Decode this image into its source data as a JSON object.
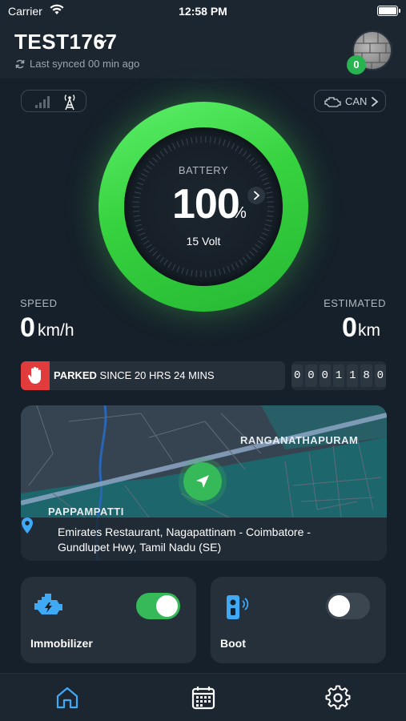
{
  "status_bar": {
    "carrier": "Carrier",
    "time": "12:58 PM"
  },
  "header": {
    "vehicle_name": "TEST1767",
    "sync_text": "Last synced 00 min ago",
    "notification_count": "0"
  },
  "connectivity": {
    "can_label": "CAN"
  },
  "battery": {
    "label": "BATTERY",
    "value": "100",
    "unit": "%",
    "voltage": "15 Volt",
    "level_percent": 100
  },
  "speed": {
    "label": "SPEED",
    "value": "0",
    "unit": "km/h"
  },
  "estimated": {
    "label": "ESTIMATED",
    "value": "0",
    "unit": "km"
  },
  "parked": {
    "status": "PARKED",
    "since_text": " SINCE 20 HRS 24 MINS"
  },
  "odometer": {
    "digits": [
      "0",
      "0",
      "0",
      "1",
      "1",
      "8",
      "0"
    ]
  },
  "map": {
    "labels": [
      "RANGANATHAPURAM",
      "PAPPAMPATTI"
    ],
    "address": "Emirates Restaurant, Nagapattinam - Coimbatore - Gundlupet Hwy, Tamil Nadu (SE)"
  },
  "controls": {
    "immobilizer": {
      "label": "Immobilizer",
      "state": "on"
    },
    "boot": {
      "label": "Boot",
      "state": "off"
    }
  },
  "colors": {
    "background": "#16202a",
    "panel": "#26303a",
    "accent_green": "#36b958",
    "alert_red": "#e23b3b",
    "tab_active": "#3fa9f5"
  },
  "tabbar": {
    "tabs": [
      {
        "icon": "home-icon",
        "active": true
      },
      {
        "icon": "calendar-icon",
        "active": false
      },
      {
        "icon": "settings-gear-icon",
        "active": false
      }
    ]
  }
}
